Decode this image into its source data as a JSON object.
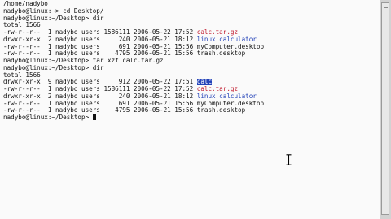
{
  "terminal": {
    "lines": [
      {
        "t0": "/home/nadybo"
      },
      {
        "t0": "nadybo@linux:~> cd Desktop/"
      },
      {
        "t0": "nadybo@linux:~/Desktop> dir"
      },
      {
        "t0": "total 1566"
      },
      {
        "t0": "-rw-r--r--  1 nadybo users 1586111 2006-05-22 17:52 ",
        "t1": "calc.tar.gz"
      },
      {
        "t0": "drwxr-xr-x  2 nadybo users     240 2006-05-21 18:12 ",
        "t1": "linux calculator"
      },
      {
        "t0": "-rw-r--r--  1 nadybo users     691 2006-05-21 15:56 myComputer.desktop"
      },
      {
        "t0": "-rw-r--r--  1 nadybo users    4795 2006-05-21 15:56 trash.desktop"
      },
      {
        "t0": "nadybo@linux:~/Desktop> tar xzf calc.tar.gz"
      },
      {
        "t0": "nadybo@linux:~/Desktop> dir"
      },
      {
        "t0": "total 1566"
      },
      {
        "t0": "drwxr-xr-x  9 nadybo users     912 2006-05-22 17:51 ",
        "t1": "calc"
      },
      {
        "t0": "-rw-r--r--  1 nadybo users 1586111 2006-05-22 17:52 ",
        "t1": "calc.tar.gz"
      },
      {
        "t0": "drwxr-xr-x  2 nadybo users     240 2006-05-21 18:12 ",
        "t1": "linux calculator"
      },
      {
        "t0": "-rw-r--r--  1 nadybo users     691 2006-05-21 15:56 myComputer.desktop"
      },
      {
        "t0": "-rw-r--r--  1 nadybo users    4795 2006-05-21 15:56 trash.desktop"
      },
      {
        "t0": "nadybo@linux:~/Desktop> "
      }
    ]
  },
  "icons": {
    "cursor": "text-cursor-icon",
    "mouse_pointer": "i-beam-cursor-icon"
  },
  "colors": {
    "archive_file": "#c0182b",
    "directory": "#2342b8",
    "selection_bg": "#2342b8",
    "text": "#111111",
    "background": "#fafafa"
  }
}
